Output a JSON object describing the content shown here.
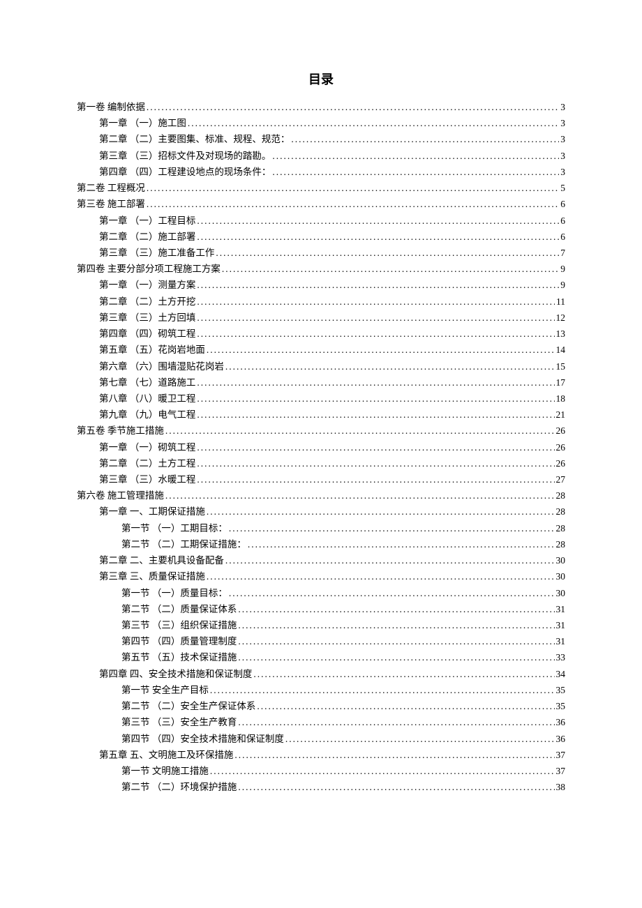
{
  "title": "目录",
  "entries": [
    {
      "indent": 0,
      "label": "第一卷 编制依据",
      "page": "3"
    },
    {
      "indent": 1,
      "label": "第一章 （一）施工图 ",
      "page": "3"
    },
    {
      "indent": 1,
      "label": "第二章 （二）主要图集、标准、规程、规范：",
      "page": "3"
    },
    {
      "indent": 1,
      "label": "第三章 （三）招标文件及对现场的踏勘。",
      "page": "3"
    },
    {
      "indent": 1,
      "label": "第四章 （四）工程建设地点的现场条件：",
      "page": "3"
    },
    {
      "indent": 0,
      "label": "第二卷 工程概况",
      "page": "5"
    },
    {
      "indent": 0,
      "label": "第三卷 施工部署",
      "page": "6"
    },
    {
      "indent": 1,
      "label": "第一章 （一）工程目标 ",
      "page": "6"
    },
    {
      "indent": 1,
      "label": "第二章 （二）施工部署 ",
      "page": "6"
    },
    {
      "indent": 1,
      "label": "第三章 （三）施工准备工作 ",
      "page": "7"
    },
    {
      "indent": 0,
      "label": "第四卷 主要分部分项工程施工方案",
      "page": "9"
    },
    {
      "indent": 1,
      "label": "第一章 （一）测量方案 ",
      "page": "9"
    },
    {
      "indent": 1,
      "label": "第二章 （二）土方开挖 ",
      "page": "11"
    },
    {
      "indent": 1,
      "label": "第三章 （三）土方回填 ",
      "page": "12"
    },
    {
      "indent": 1,
      "label": "第四章 （四）砌筑工程 ",
      "page": "13"
    },
    {
      "indent": 1,
      "label": "第五章 （五）花岗岩地面 ",
      "page": "14"
    },
    {
      "indent": 1,
      "label": "第六章 （六）围墙湿贴花岗岩 ",
      "page": "15"
    },
    {
      "indent": 1,
      "label": "第七章 （七）道路施工 ",
      "page": "17"
    },
    {
      "indent": 1,
      "label": "第八章 （八）暖卫工程 ",
      "page": "18"
    },
    {
      "indent": 1,
      "label": "第九章 （九）电气工程 ",
      "page": "21"
    },
    {
      "indent": 0,
      "label": "第五卷 季节施工措施",
      "page": "26"
    },
    {
      "indent": 1,
      "label": "第一章 （一）砌筑工程 ",
      "page": "26"
    },
    {
      "indent": 1,
      "label": "第二章 （二）土方工程 ",
      "page": "26"
    },
    {
      "indent": 1,
      "label": "第三章 （三）水暖工程 ",
      "page": "27"
    },
    {
      "indent": 0,
      "label": "第六卷 施工管理措施",
      "page": "28"
    },
    {
      "indent": 1,
      "label": "第一章 一、工期保证措施 ",
      "page": "28"
    },
    {
      "indent": 2,
      "label": "第一节 （一）工期目标：",
      "page": "28"
    },
    {
      "indent": 2,
      "label": "第二节 （二）工期保证措施：",
      "page": "28"
    },
    {
      "indent": 1,
      "label": "第二章 二、主要机具设备配备 ",
      "page": "30"
    },
    {
      "indent": 1,
      "label": "第三章 三、质量保证措施 ",
      "page": "30"
    },
    {
      "indent": 2,
      "label": "第一节 （一）质量目标：",
      "page": "30"
    },
    {
      "indent": 2,
      "label": "第二节 （二）质量保证体系",
      "page": "31"
    },
    {
      "indent": 2,
      "label": "第三节 （三）组织保证措施",
      "page": "31"
    },
    {
      "indent": 2,
      "label": "第四节 （四）质量管理制度",
      "page": "31"
    },
    {
      "indent": 2,
      "label": "第五节 （五）技术保证措施",
      "page": "33"
    },
    {
      "indent": 1,
      "label": "第四章 四、安全技术措施和保证制度 ",
      "page": "34"
    },
    {
      "indent": 2,
      "label": "第一节 安全生产目标",
      "page": "35"
    },
    {
      "indent": 2,
      "label": "第二节 （二）安全生产保证体系",
      "page": "35"
    },
    {
      "indent": 2,
      "label": "第三节 （三）安全生产教育",
      "page": "36"
    },
    {
      "indent": 2,
      "label": "第四节 （四）安全技术措施和保证制度",
      "page": "36"
    },
    {
      "indent": 1,
      "label": "第五章 五、文明施工及环保措施 ",
      "page": "37"
    },
    {
      "indent": 2,
      "label": "第一节 文明施工措施",
      "page": "37"
    },
    {
      "indent": 2,
      "label": "第二节 （二）环境保护措施",
      "page": "38"
    }
  ]
}
